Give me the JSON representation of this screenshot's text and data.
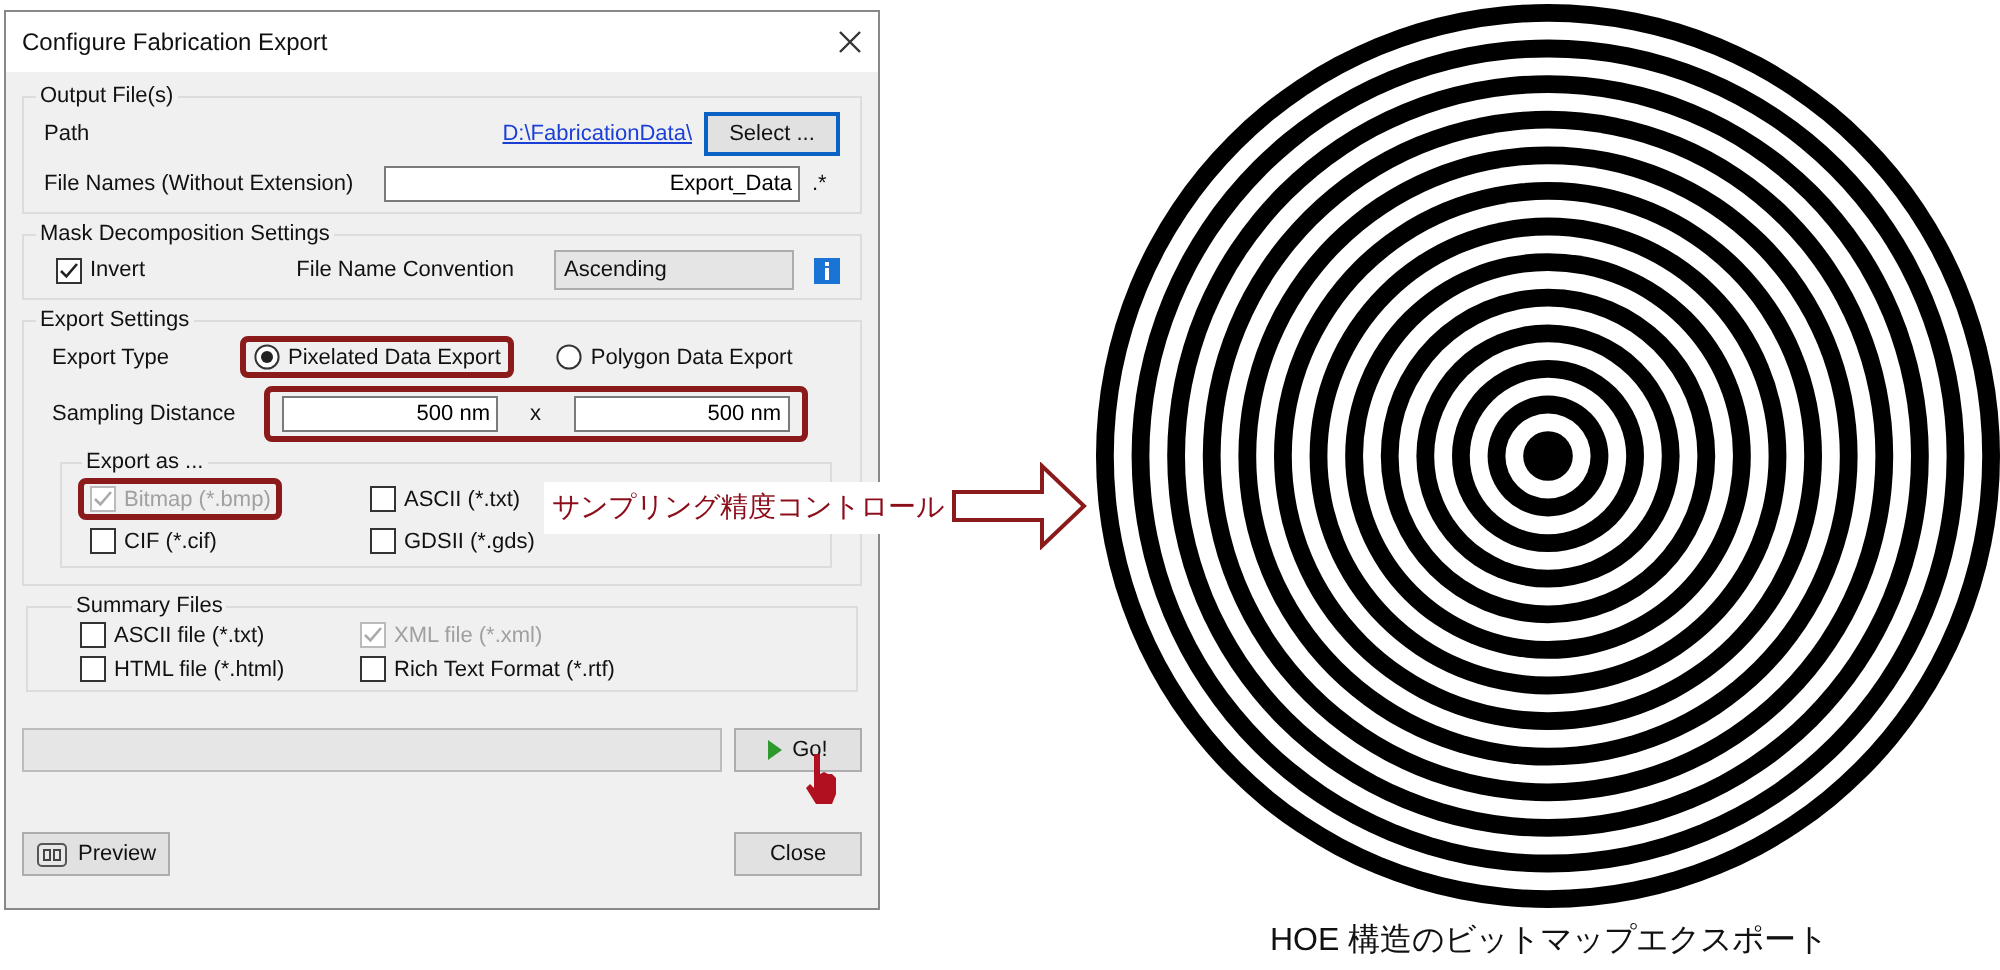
{
  "dialog": {
    "title": "Configure Fabrication Export",
    "output_files": {
      "legend": "Output File(s)",
      "path_label": "Path",
      "path_link": "D:\\FabricationData\\",
      "select_button": "Select ...",
      "file_names_label": "File Names (Without Extension)",
      "file_names_value": "Export_Data",
      "extension": ".*"
    },
    "mask": {
      "legend": "Mask Decomposition Settings",
      "invert": {
        "label": "Invert",
        "checked": true
      },
      "convention_label": "File Name Convention",
      "convention_value": "Ascending"
    },
    "export": {
      "legend": "Export Settings",
      "type_label": "Export Type",
      "types": [
        {
          "label": "Pixelated Data Export",
          "selected": true,
          "highlighted": true
        },
        {
          "label": "Polygon Data Export",
          "selected": false,
          "highlighted": false
        }
      ],
      "sampling_label": "Sampling Distance",
      "sampling_highlighted": true,
      "sampling_x": "500 nm",
      "sampling_separator": "x",
      "sampling_y": "500 nm",
      "export_as": {
        "legend": "Export as ...",
        "options": [
          {
            "label": "Bitmap (*.bmp)",
            "checked": true,
            "disabled": true,
            "highlighted": true
          },
          {
            "label": "ASCII (*.txt)",
            "checked": false,
            "disabled": false,
            "highlighted": false
          },
          {
            "label": "CIF (*.cif)",
            "checked": false,
            "disabled": false,
            "highlighted": false
          },
          {
            "label": "GDSII (*.gds)",
            "checked": false,
            "disabled": false,
            "highlighted": false
          }
        ]
      }
    },
    "summary": {
      "legend": "Summary Files",
      "options": [
        {
          "label": "ASCII file (*.txt)",
          "checked": false,
          "disabled": false
        },
        {
          "label": "XML file (*.xml)",
          "checked": true,
          "disabled": true
        },
        {
          "label": "HTML file (*.html)",
          "checked": false,
          "disabled": false
        },
        {
          "label": "Rich Text Format (*.rtf)",
          "checked": false,
          "disabled": false
        }
      ]
    },
    "progress": {
      "level": 0
    },
    "go_button": "Go!",
    "preview_button": "Preview",
    "close_button": "Close"
  },
  "annotation": {
    "label": "サンプリング精度コントロール"
  },
  "figure": {
    "caption": "HOE 構造のビットマップエクスポート"
  }
}
